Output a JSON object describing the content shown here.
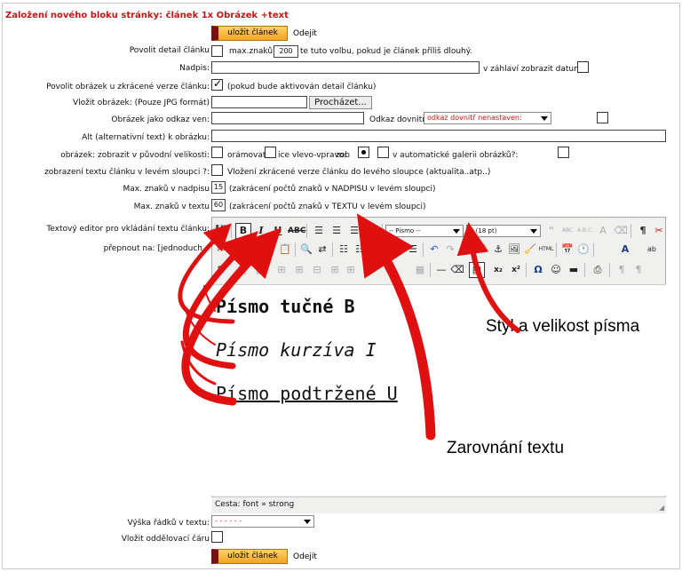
{
  "form": {
    "title": "Založení nového bloku stránky: článek 1x Obrázek +text",
    "save_label": "uložit článek",
    "cancel_label": "Odejít",
    "detail": {
      "label": "Povolit detail článku",
      "maxchars_label": "max.znaků:",
      "maxchars_value": "200",
      "hint": "te tuto volbu, pokud je článek příliš dlouhý."
    },
    "heading": {
      "label": "Nadpis:",
      "date_label": "v záhlaví zobrazit datum:"
    },
    "short_image": {
      "label": "Povolit obrázek u zkrácené verze článku:",
      "hint": "(pokud bude aktivován detail článku)"
    },
    "insert_image": {
      "label": "Vložit obrázek: (Pouze JPG formát)",
      "browse_label": "Procházet..."
    },
    "image_link": {
      "label": "Obrázek jako odkaz ven:",
      "inner_label": "Odkaz dovnitř:",
      "inner_value": "odkaz dovnitř nenastaven:"
    },
    "alt": {
      "label": "Alt (alternativní text) k obrázku:"
    },
    "orig_size": {
      "label": "obrázek: zobrazit v původní velikosti:",
      "frame_label": "orámovat",
      "align_label": "ice vlevo-vpravo:",
      "zob_label": "zob",
      "gallery_label": "v automatické galerii obrázků?:"
    },
    "left_col": {
      "label": "zobrazení textu článku v levém sloupci ?:",
      "hint": "Vložení zkrácené verze článku do levého sloupce (aktualita..atp..)"
    },
    "max_heading": {
      "label": "Max. znaků v nadpisu",
      "value": "15",
      "hint": "(zakrácení počtů znaků v NADPISU v levém sloupci)"
    },
    "max_text": {
      "label": "Max. znaků v textu",
      "value": "60",
      "hint": "(zakrácení počtů znaků v TEXTU v levém sloupci)"
    },
    "editor_label": "Textový editor pro vkládání textu článku:",
    "switch_label": "přepnout na: [jednoduch",
    "row_height": {
      "label": "Výška řádků v textu:",
      "value": "- - - - - -"
    },
    "divider": {
      "label": "Vložit oddělovací čáru"
    }
  },
  "editor": {
    "font_family": "-- Písmo --",
    "font_size": "5 (18 pt)",
    "quote_label": "ABC",
    "abc_label": "A.B.C.",
    "status": "Cesta: font » strong",
    "content": {
      "bold": "Písmo tučné B",
      "italic": "Písmo kurzíva I",
      "underline": "Písmo podtržené U"
    }
  },
  "annotations": {
    "style": "Styl a velikost písma",
    "align": "Zarovnání textu"
  },
  "colors": {
    "title": "#c81414",
    "arrow": "#e01010",
    "button": "#f3a321"
  }
}
